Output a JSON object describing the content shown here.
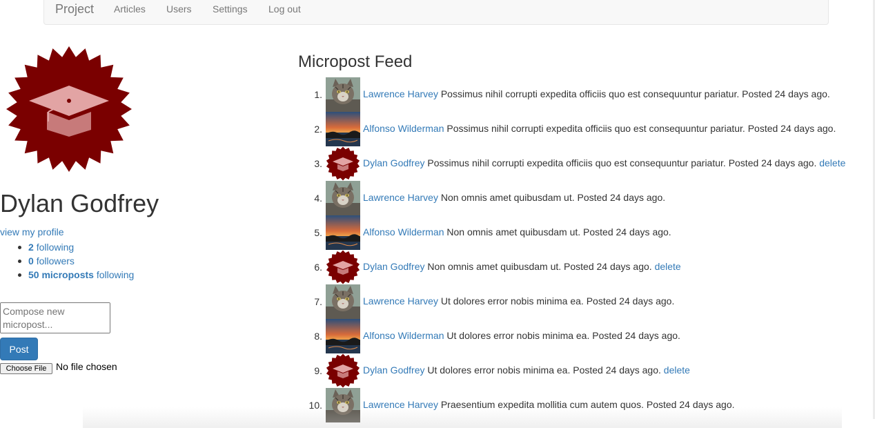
{
  "nav": {
    "brand": "Project",
    "links": [
      "Articles",
      "Users",
      "Settings",
      "Log out"
    ]
  },
  "profile": {
    "name": "Dylan Godfrey",
    "view_profile": "view my profile",
    "stats": [
      {
        "count": "2",
        "label": "following"
      },
      {
        "count": "0",
        "label": "followers"
      },
      {
        "count": "50 microposts",
        "label": "following"
      }
    ]
  },
  "compose": {
    "placeholder": "Compose new micropost...",
    "post_label": "Post",
    "choose_file_label": "Choose File",
    "no_file_text": "No file chosen"
  },
  "feed": {
    "title": "Micropost Feed",
    "items": [
      {
        "num": "1.",
        "author": "Lawrence Harvey",
        "avatar": "cat-avatar",
        "text": "Possimus nihil corrupti expedita officiis quo est consequuntur pariatur.",
        "posted": "Posted 24 days ago.",
        "delete": ""
      },
      {
        "num": "2.",
        "author": "Alfonso Wilderman",
        "avatar": "sunset-avatar",
        "text": "Possimus nihil corrupti expedita officiis quo est consequuntur pariatur.",
        "posted": "Posted 24 days ago.",
        "delete": ""
      },
      {
        "num": "3.",
        "author": "Dylan Godfrey",
        "avatar": "graduation-cap-avatar",
        "text": "Possimus nihil corrupti expedita officiis quo est consequuntur pariatur.",
        "posted": "Posted 24 days ago.",
        "delete": "delete"
      },
      {
        "num": "4.",
        "author": "Lawrence Harvey",
        "avatar": "cat-avatar",
        "text": "Non omnis amet quibusdam ut.",
        "posted": "Posted 24 days ago.",
        "delete": ""
      },
      {
        "num": "5.",
        "author": "Alfonso Wilderman",
        "avatar": "sunset-avatar",
        "text": "Non omnis amet quibusdam ut.",
        "posted": "Posted 24 days ago.",
        "delete": ""
      },
      {
        "num": "6.",
        "author": "Dylan Godfrey",
        "avatar": "graduation-cap-avatar",
        "text": "Non omnis amet quibusdam ut.",
        "posted": "Posted 24 days ago.",
        "delete": "delete"
      },
      {
        "num": "7.",
        "author": "Lawrence Harvey",
        "avatar": "cat-avatar",
        "text": "Ut dolores error nobis minima ea.",
        "posted": "Posted 24 days ago.",
        "delete": ""
      },
      {
        "num": "8.",
        "author": "Alfonso Wilderman",
        "avatar": "sunset-avatar",
        "text": "Ut dolores error nobis minima ea.",
        "posted": "Posted 24 days ago.",
        "delete": ""
      },
      {
        "num": "9.",
        "author": "Dylan Godfrey",
        "avatar": "graduation-cap-avatar",
        "text": "Ut dolores error nobis minima ea.",
        "posted": "Posted 24 days ago.",
        "delete": "delete"
      },
      {
        "num": "10.",
        "author": "Lawrence Harvey",
        "avatar": "cat-avatar",
        "text": "Praesentium expedita mollitia cum autem quos.",
        "posted": "Posted 24 days ago.",
        "delete": ""
      }
    ]
  },
  "colors": {
    "link": "#337ab7",
    "brand_maroon": "#7a0000",
    "button_primary": "#337ab7",
    "navbar_bg": "#f8f8f8"
  }
}
